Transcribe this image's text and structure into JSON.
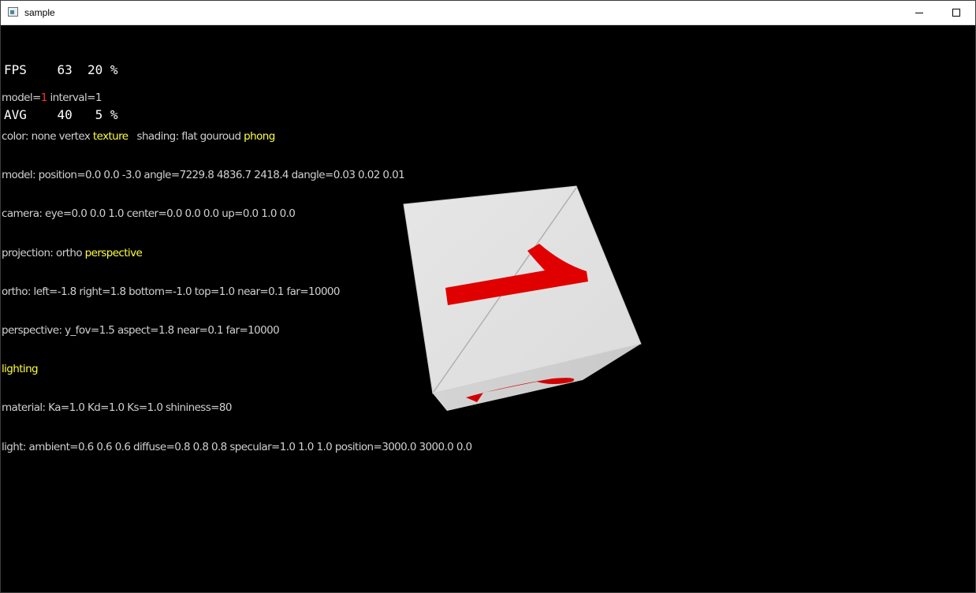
{
  "window": {
    "title": "sample",
    "minimize_label": "minimize",
    "maximize_label": "maximize"
  },
  "stats": {
    "fps_label": "FPS",
    "fps_value": "63",
    "fps_percent": "20 %",
    "avg_label": "AVG",
    "avg_value": "40",
    "avg_percent": "5 %"
  },
  "info": {
    "model_prefix": "model=",
    "model_value": "1",
    "interval": " interval=1",
    "color_prefix": "color: none vertex ",
    "color_selected": "texture",
    "shading_prefix": "   shading: flat gouroud ",
    "shading_selected": "phong",
    "model_line": "model: position=0.0 0.0 -3.0 angle=7229.8 4836.7 2418.4 dangle=0.03 0.02 0.01",
    "camera_line": "camera: eye=0.0 0.0 1.0 center=0.0 0.0 0.0 up=0.0 1.0 0.0",
    "projection_prefix": "projection: ortho ",
    "projection_selected": "perspective",
    "ortho_line": "ortho: left=-1.8 right=1.8 bottom=-1.0 top=1.0 near=0.1 far=10000",
    "perspective_line": "perspective: y_fov=1.5 aspect=1.8 near=0.1 far=10000",
    "lighting": "lighting",
    "material_line": "material: Ka=1.0 Kd=1.0 Ks=1.0 shininess=80",
    "light_line": "light: ambient=0.6 0.6 0.6 diffuse=0.8 0.8 0.8 specular=1.0 1.0 1.0 position=3000.0 3000.0 0.0"
  },
  "colors": {
    "highlight": "#ffff40",
    "model_number": "#ff3030",
    "cube_face": "#e2e2e2",
    "cube_mark": "#e00000"
  }
}
